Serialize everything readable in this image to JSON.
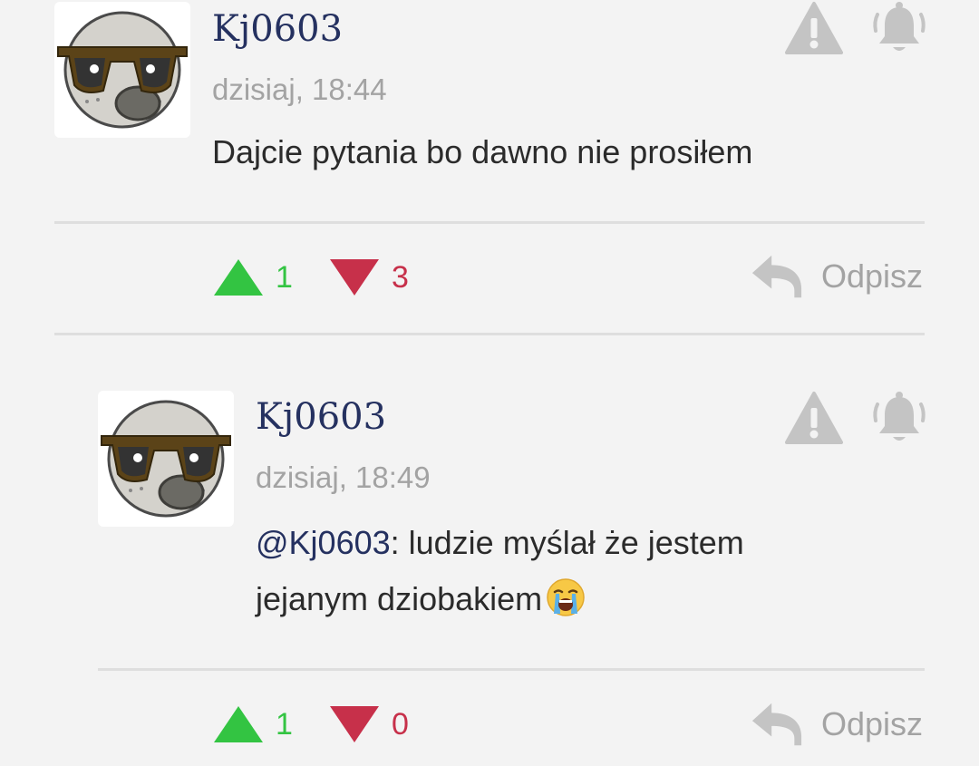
{
  "comments": [
    {
      "username": "Kj0603",
      "timestamp": "dzisiaj, 18:44",
      "body": "Dajcie pytania bo dawno nie prosiłem",
      "mention": "",
      "upvotes": "1",
      "downvotes": "3",
      "reply_label": "Odpisz"
    },
    {
      "username": "Kj0603",
      "timestamp": "dzisiaj, 18:49",
      "mention": "@Kj0603",
      "body_line1": ": ludzie myślał że jestem",
      "body_line2": "jejanym dziobakiem",
      "upvotes": "1",
      "downvotes": "0",
      "reply_label": "Odpisz"
    }
  ],
  "icons": {
    "report": "warning-triangle-icon",
    "notify": "bell-icon",
    "upvote": "triangle-up-icon",
    "downvote": "triangle-down-icon",
    "reply": "reply-arrow-icon",
    "emoji": "loudly-crying-face-emoji"
  },
  "colors": {
    "username": "#253160",
    "upvote": "#33c442",
    "downvote": "#c7304a",
    "muted": "#a3a3a3",
    "icon_gray": "#c4c4c4"
  }
}
